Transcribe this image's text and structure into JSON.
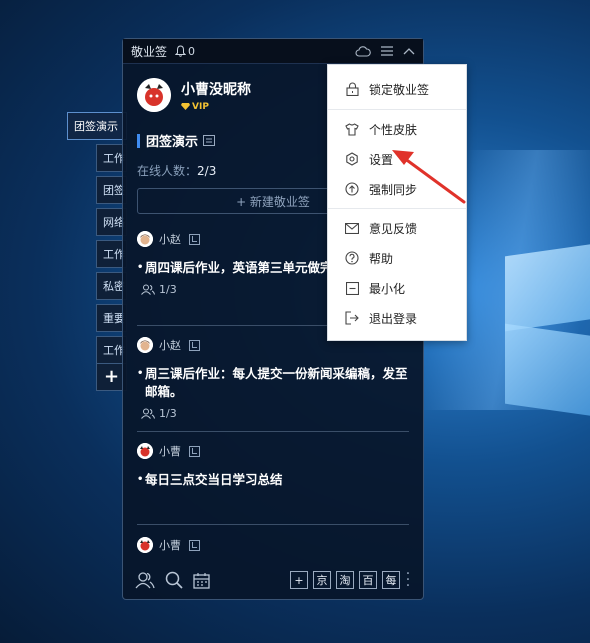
{
  "window": {
    "app_title": "敬业签",
    "notification_count": "0"
  },
  "profile": {
    "nickname": "小曹没昵称",
    "vip_label": "VIP"
  },
  "group": {
    "name": "团签演示",
    "online_label": "在线人数：",
    "online_value": "2/3",
    "new_button": "+ 新建敬业签"
  },
  "side_tabs": [
    {
      "label": "团签演示",
      "active": true
    },
    {
      "label": "工作"
    },
    {
      "label": "团签"
    },
    {
      "label": "网络"
    },
    {
      "label": "工作"
    },
    {
      "label": "私密"
    },
    {
      "label": "重要"
    },
    {
      "label": "工作"
    },
    {
      "label": "+"
    }
  ],
  "notes": [
    {
      "author": "小赵",
      "text": "周四课后作业，英语第三单元做完。",
      "count": "1/3"
    },
    {
      "author": "小赵",
      "text": "周三课后作业：每人提交一份新闻采编稿，发至邮箱。",
      "count": "1/3"
    },
    {
      "author": "小曹",
      "text": "每日三点交当日学习总结"
    },
    {
      "author": "小曹"
    }
  ],
  "footer": {
    "buttons": [
      "+",
      "京",
      "淘",
      "百",
      "每"
    ]
  },
  "menu": {
    "items": [
      {
        "label": "锁定敬业签",
        "icon": "lock-icon"
      },
      {
        "label": "个性皮肤",
        "icon": "shirt-icon"
      },
      {
        "label": "设置",
        "icon": "settings-icon"
      },
      {
        "label": "强制同步",
        "icon": "sync-icon"
      },
      {
        "label": "意见反馈",
        "icon": "mail-icon"
      },
      {
        "label": "帮助",
        "icon": "help-icon"
      },
      {
        "label": "最小化",
        "icon": "minimize-icon"
      },
      {
        "label": "退出登录",
        "icon": "logout-icon"
      }
    ]
  },
  "colors": {
    "accent": "#3f8cf0",
    "vip": "#f3c233",
    "annotation_arrow": "#e0322a"
  }
}
